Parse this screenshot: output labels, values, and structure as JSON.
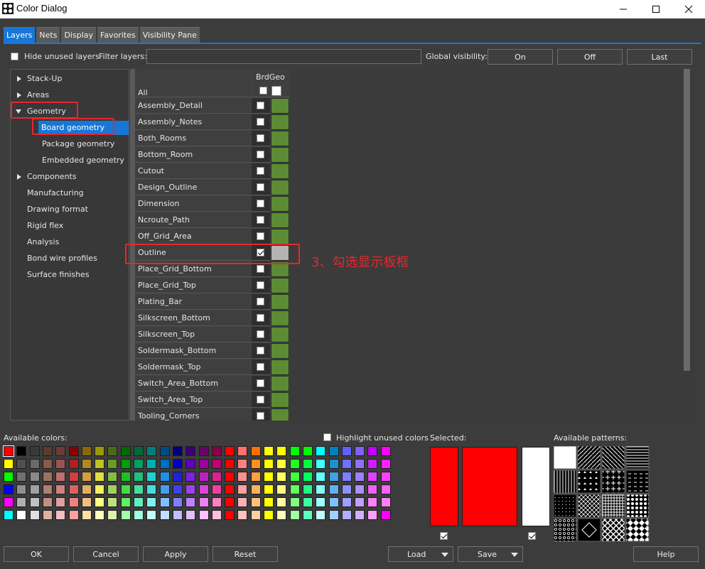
{
  "window": {
    "title": "Color Dialog"
  },
  "tabs": [
    "Layers",
    "Nets",
    "Display",
    "Favorites",
    "Visibility Pane"
  ],
  "topbar": {
    "hide_unused_label": "Hide unused layers",
    "filter_label": "Filter layers:",
    "filter_value": "",
    "global_visibility_label": "Global visibility:",
    "on_label": "On",
    "off_label": "Off",
    "last_label": "Last"
  },
  "tree": [
    {
      "label": "Stack-Up",
      "indent": 0,
      "arrow": "right",
      "selected": false
    },
    {
      "label": "Areas",
      "indent": 0,
      "arrow": "right",
      "selected": false
    },
    {
      "label": "Geometry",
      "indent": 0,
      "arrow": "down",
      "selected": false
    },
    {
      "label": "Board geometry",
      "indent": 1,
      "arrow": "",
      "selected": true
    },
    {
      "label": "Package geometry",
      "indent": 1,
      "arrow": "",
      "selected": false
    },
    {
      "label": "Embedded geometry",
      "indent": 1,
      "arrow": "",
      "selected": false
    },
    {
      "label": "Components",
      "indent": 0,
      "arrow": "right",
      "selected": false
    },
    {
      "label": "Manufacturing",
      "indent": 0,
      "arrow": "",
      "selected": false
    },
    {
      "label": "Drawing format",
      "indent": 0,
      "arrow": "",
      "selected": false
    },
    {
      "label": "Rigid flex",
      "indent": 0,
      "arrow": "",
      "selected": false
    },
    {
      "label": "Analysis",
      "indent": 0,
      "arrow": "",
      "selected": false
    },
    {
      "label": "Bond wire profiles",
      "indent": 0,
      "arrow": "",
      "selected": false
    },
    {
      "label": "Surface finishes",
      "indent": 0,
      "arrow": "",
      "selected": false
    }
  ],
  "grid": {
    "column_header": "BrdGeo",
    "all_label": "All",
    "layers": [
      {
        "name": "Assembly_Detail",
        "checked": false,
        "color": "#5c8a35"
      },
      {
        "name": "Assembly_Notes",
        "checked": false,
        "color": "#5c8a35"
      },
      {
        "name": "Both_Rooms",
        "checked": false,
        "color": "#5c8a35"
      },
      {
        "name": "Bottom_Room",
        "checked": false,
        "color": "#5c8a35"
      },
      {
        "name": "Cutout",
        "checked": false,
        "color": "#5c8a35"
      },
      {
        "name": "Design_Outline",
        "checked": false,
        "color": "#5c8a35"
      },
      {
        "name": "Dimension",
        "checked": false,
        "color": "#5c8a35"
      },
      {
        "name": "Ncroute_Path",
        "checked": false,
        "color": "#5c8a35"
      },
      {
        "name": "Off_Grid_Area",
        "checked": false,
        "color": "#5c8a35"
      },
      {
        "name": "Outline",
        "checked": true,
        "color": "#b4b4b4"
      },
      {
        "name": "Place_Grid_Bottom",
        "checked": false,
        "color": "#5c8a35"
      },
      {
        "name": "Place_Grid_Top",
        "checked": false,
        "color": "#5c8a35"
      },
      {
        "name": "Plating_Bar",
        "checked": false,
        "color": "#5c8a35"
      },
      {
        "name": "Silkscreen_Bottom",
        "checked": false,
        "color": "#5c8a35"
      },
      {
        "name": "Silkscreen_Top",
        "checked": false,
        "color": "#5c8a35"
      },
      {
        "name": "Soldermask_Bottom",
        "checked": false,
        "color": "#5c8a35"
      },
      {
        "name": "Soldermask_Top",
        "checked": false,
        "color": "#5c8a35"
      },
      {
        "name": "Switch_Area_Bottom",
        "checked": false,
        "color": "#5c8a35"
      },
      {
        "name": "Switch_Area_Top",
        "checked": false,
        "color": "#5c8a35"
      },
      {
        "name": "Tooling_Corners",
        "checked": false,
        "color": "#5c8a35"
      }
    ]
  },
  "annotation": {
    "text": "3、勾选显示板框"
  },
  "colors_section": {
    "available_label": "Available colors:",
    "highlight_label": "Highlight unused colors",
    "selected_label": "Selected:",
    "patterns_label": "Available patterns:",
    "selected_primary": "#ff0000",
    "selected_secondary": "#ffffff",
    "rows": [
      [
        "#ff0000",
        "#000000",
        "#3a3a3a",
        "#5e3a2c",
        "#6e3a3a",
        "#8a0000",
        "#8a6a00",
        "#9a9a00",
        "#4a6a1a",
        "#006a00",
        "#006a3a",
        "#00807a",
        "#004a8a",
        "#00007a",
        "#3a007a",
        "#6a006a",
        "#8a0046",
        "#ff0000",
        "#ff7070",
        "#ff7000",
        "#ffff00",
        "#ffff00",
        "#00ff00",
        "#00ff00",
        "#00ffff",
        "#0080c0",
        "#6060ff",
        "#8060ff",
        "#c000ff",
        "#ff00ff"
      ],
      [
        "#ffff00",
        "#505050",
        "#6a6a6a",
        "#8a5a4a",
        "#a05050",
        "#b02020",
        "#b08a20",
        "#c0c020",
        "#6a9a2a",
        "#00a000",
        "#00a060",
        "#00b0b0",
        "#0070c0",
        "#0000c0",
        "#6000c0",
        "#a000a0",
        "#c00070",
        "#ff0000",
        "#ff8080",
        "#ff9020",
        "#ffff00",
        "#ffff40",
        "#20ff20",
        "#00ff40",
        "#40ffff",
        "#2090d0",
        "#7070ff",
        "#9070ff",
        "#d020ff",
        "#ff20ff"
      ],
      [
        "#00ff00",
        "#707070",
        "#8a8a8a",
        "#a07060",
        "#c07070",
        "#d04040",
        "#d0a040",
        "#e0e040",
        "#80c040",
        "#20c020",
        "#20c080",
        "#20d0d0",
        "#2090e0",
        "#2020e0",
        "#8020e0",
        "#c020c0",
        "#e02090",
        "#ff0000",
        "#ff9090",
        "#ffa040",
        "#ffff00",
        "#ffff60",
        "#40ff40",
        "#00ff60",
        "#60ffff",
        "#40a0e0",
        "#8080ff",
        "#a080ff",
        "#e040ff",
        "#ff40ff"
      ],
      [
        "#0000ff",
        "#909090",
        "#a0a0a0",
        "#b08070",
        "#d08080",
        "#e06060",
        "#e0b060",
        "#f0f060",
        "#a0d060",
        "#40e040",
        "#40e0a0",
        "#40e0e0",
        "#40a0f0",
        "#4040f0",
        "#a040f0",
        "#e040e0",
        "#f040a0",
        "#ff0000",
        "#ffa0a0",
        "#ffb060",
        "#ffff00",
        "#ffff80",
        "#60ff60",
        "#20ff80",
        "#80ffff",
        "#60b0f0",
        "#9090ff",
        "#b090ff",
        "#f060ff",
        "#ff60ff"
      ],
      [
        "#ff00ff",
        "#b0b0b0",
        "#c0c0c0",
        "#c09080",
        "#e0a0a0",
        "#f08080",
        "#f0c080",
        "#ffff80",
        "#c0e080",
        "#60f060",
        "#60f0c0",
        "#80f0f0",
        "#80c0ff",
        "#8080ff",
        "#c080ff",
        "#f080f0",
        "#ff80c0",
        "#ff0000",
        "#ffb0b0",
        "#ffc080",
        "#ffff00",
        "#ffffa0",
        "#80ff80",
        "#40ffa0",
        "#a0ffff",
        "#80c0ff",
        "#a0a0ff",
        "#c0a0ff",
        "#ff80ff",
        "#ff80ff"
      ],
      [
        "#00ffff",
        "#ffffff",
        "#e0e0e0",
        "#e0b0a0",
        "#f0c0c0",
        "#ffa0a0",
        "#ffe0a0",
        "#ffffc0",
        "#e0f0b0",
        "#a0ffa0",
        "#a0ffe0",
        "#c0ffff",
        "#c0e0ff",
        "#c0c0ff",
        "#e0c0ff",
        "#ffc0ff",
        "#ffc0e0",
        "#ff0000",
        "#ffc0c0",
        "#ffd0a0",
        "#ffff00",
        "#ffffc0",
        "#a0ffa0",
        "#60ffc0",
        "#c0ffff",
        "#a0d0ff",
        "#b0b0ff",
        "#d0b0ff",
        "#ffa0ff",
        "#ff00ff"
      ]
    ]
  },
  "buttons": {
    "ok": "OK",
    "cancel": "Cancel",
    "apply": "Apply",
    "reset": "Reset",
    "load": "Load",
    "save": "Save",
    "help": "Help"
  }
}
